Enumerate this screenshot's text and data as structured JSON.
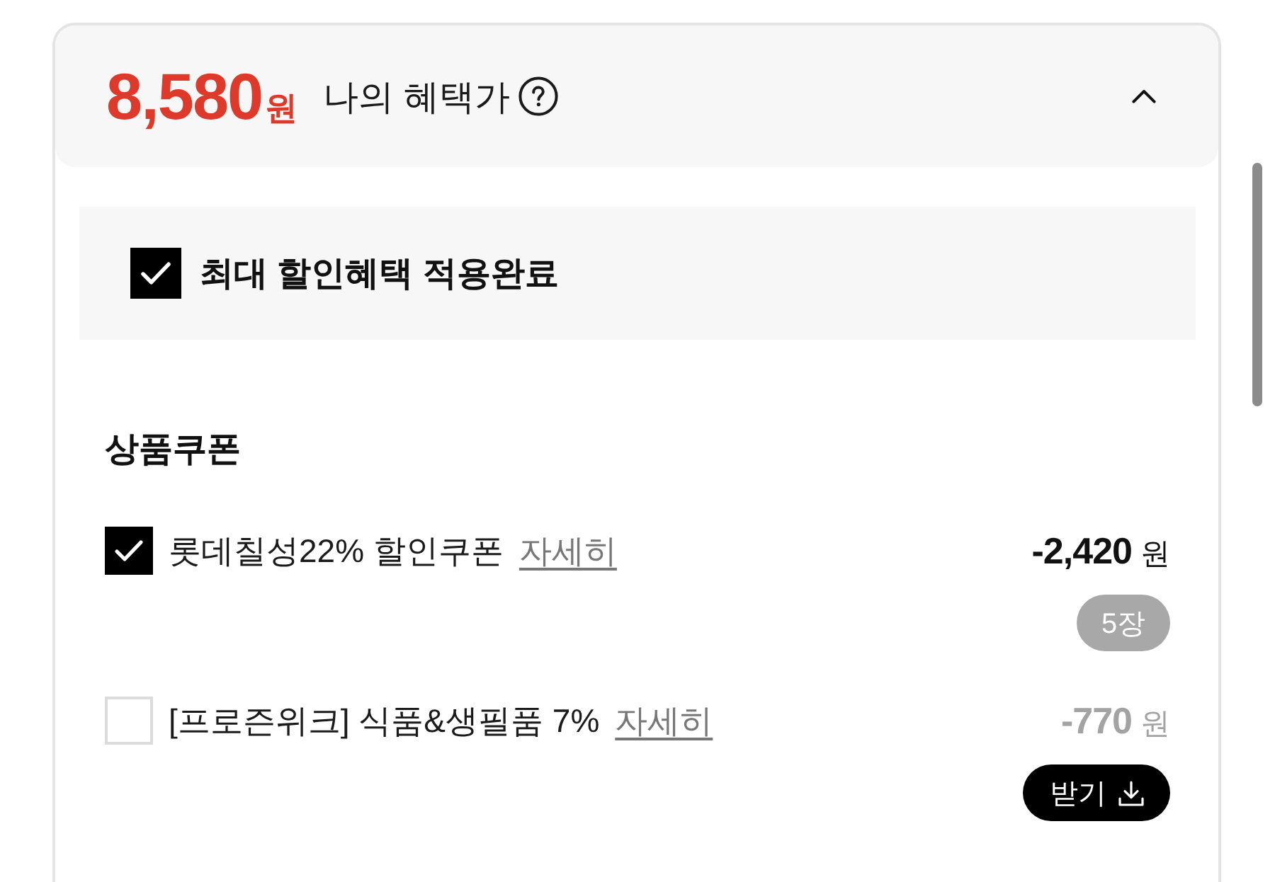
{
  "header": {
    "price": "8,580",
    "currency": "원",
    "label": "나의 혜택가",
    "expanded": true
  },
  "max_discount": {
    "label": "최대 할인혜택 적용완료",
    "checked": true
  },
  "section": {
    "title": "상품쿠폰"
  },
  "coupons": [
    {
      "kind": "count",
      "name": "롯데칠성22% 할인쿠폰",
      "link": "자세히",
      "checked": true,
      "amount": "-2,420",
      "currency": "원",
      "badge": "5장"
    },
    {
      "kind": "download",
      "name": "[프로즌위크] 식품&생필품 7%",
      "link": "자세히",
      "checked": false,
      "amount": "-770",
      "currency": "원",
      "action": "받기"
    }
  ]
}
